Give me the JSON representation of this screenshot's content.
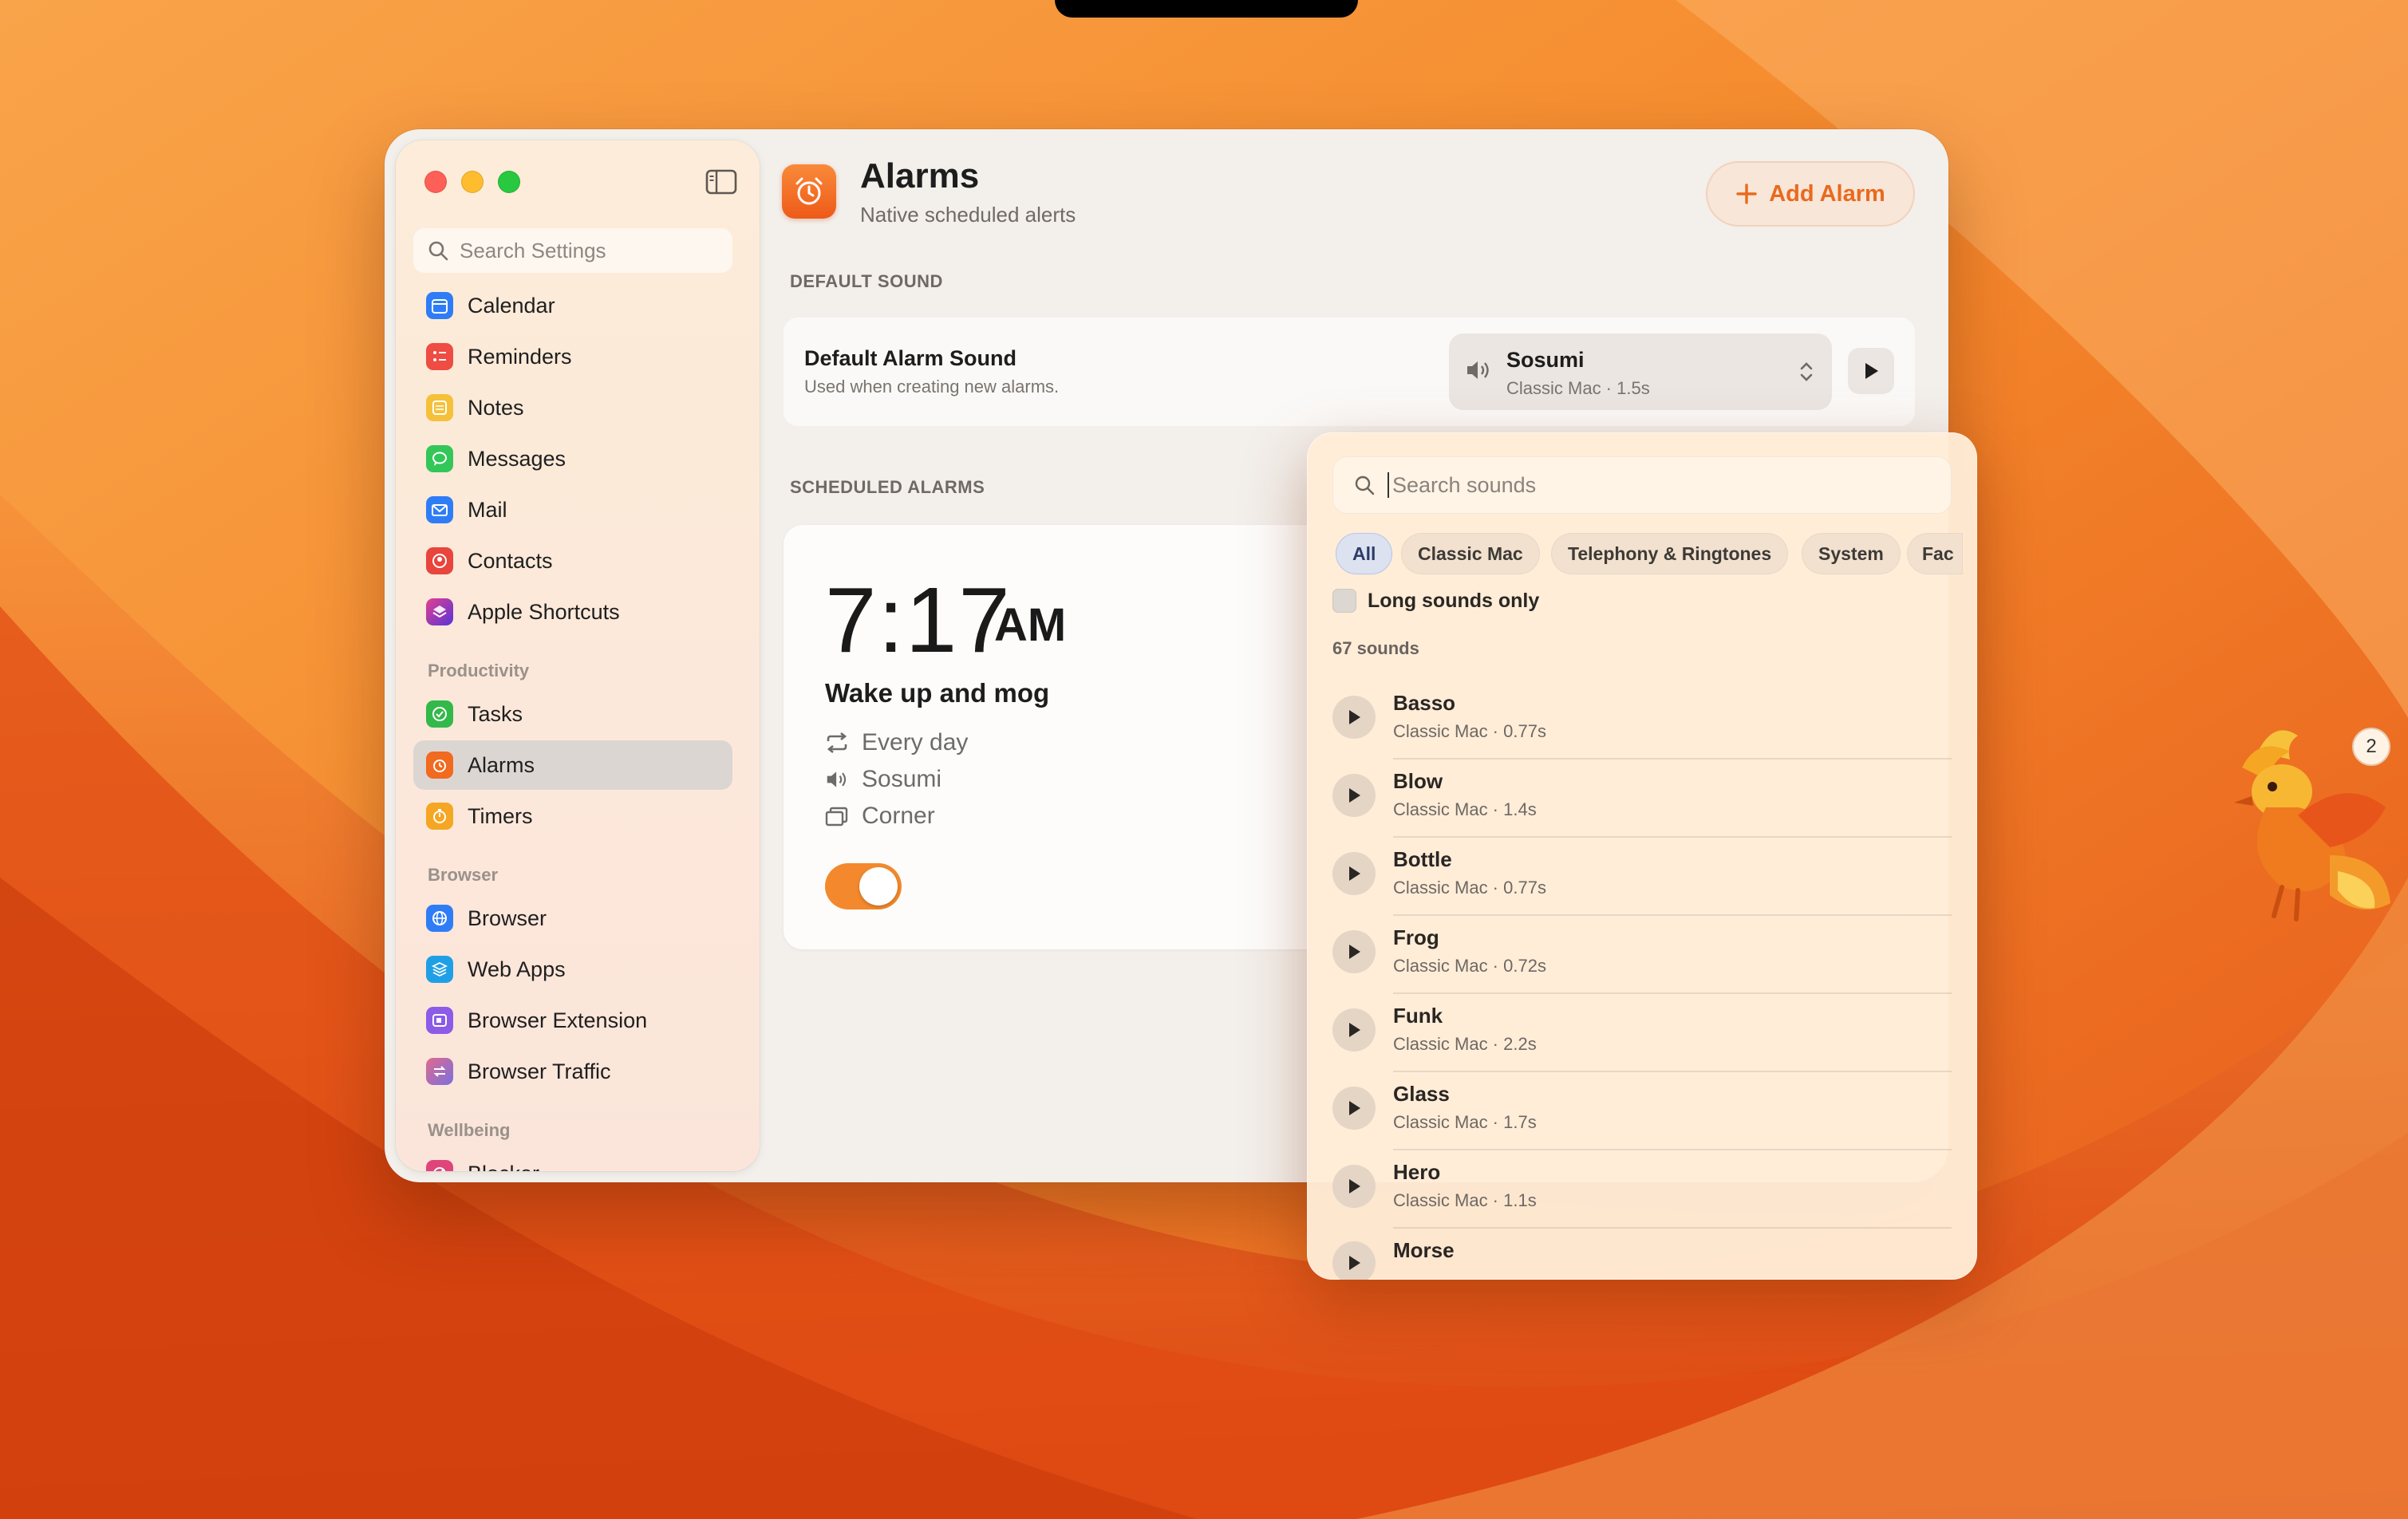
{
  "sidebar": {
    "search_placeholder": "Search Settings",
    "items": [
      {
        "label": "Calendar",
        "icon": "calendar-icon",
        "color": "#2f7df6"
      },
      {
        "label": "Reminders",
        "icon": "reminders-icon",
        "color": "#ef4c43"
      },
      {
        "label": "Notes",
        "icon": "notes-icon",
        "color": "#f5c13a"
      },
      {
        "label": "Messages",
        "icon": "messages-icon",
        "color": "#33c759"
      },
      {
        "label": "Mail",
        "icon": "mail-icon",
        "color": "#2f7df6"
      },
      {
        "label": "Contacts",
        "icon": "contacts-icon",
        "color": "#e8453c"
      },
      {
        "label": "Apple Shortcuts",
        "icon": "shortcuts-icon",
        "color": "#7c3cd9"
      }
    ],
    "section_productivity": "Productivity",
    "productivity_items": [
      {
        "label": "Tasks",
        "icon": "tasks-icon",
        "color": "#33b84a"
      },
      {
        "label": "Alarms",
        "icon": "alarm-icon",
        "color": "#f06a1f"
      },
      {
        "label": "Timers",
        "icon": "timer-icon",
        "color": "#f5a623"
      }
    ],
    "section_browser": "Browser",
    "browser_items": [
      {
        "label": "Browser",
        "icon": "globe-icon",
        "color": "#2f7df6"
      },
      {
        "label": "Web Apps",
        "icon": "web-apps-icon",
        "color": "#1fa0e6"
      },
      {
        "label": "Browser Extension",
        "icon": "extension-icon",
        "color": "#8c5be8"
      },
      {
        "label": "Browser Traffic",
        "icon": "traffic-icon",
        "color": "#8a6fd6"
      }
    ],
    "section_wellbeing": "Wellbeing",
    "wellbeing_items": [
      {
        "label": "Blocker",
        "icon": "blocker-icon",
        "color": "#e0457a"
      }
    ]
  },
  "header": {
    "title": "Alarms",
    "subtitle": "Native scheduled alerts",
    "add_label": "Add Alarm"
  },
  "default_sound": {
    "section": "DEFAULT SOUND",
    "title": "Default Alarm Sound",
    "subtitle": "Used when creating new alarms.",
    "selected_name": "Sosumi",
    "selected_meta": "Classic Mac · 1.5s"
  },
  "scheduled": {
    "section": "SCHEDULED ALARMS",
    "alarm": {
      "time": "7:17",
      "ampm": "AM",
      "label": "Wake up and mog",
      "repeat": "Every day",
      "sound": "Sosumi",
      "position": "Corner",
      "enabled": true
    }
  },
  "popover": {
    "search_placeholder": "Search sounds",
    "chips": [
      "All",
      "Classic Mac",
      "Telephony & Ringtones",
      "System",
      "Fac"
    ],
    "selected_chip": "All",
    "long_only_label": "Long sounds only",
    "count_label": "67 sounds",
    "sounds": [
      {
        "name": "Basso",
        "meta": "Classic Mac · 0.77s"
      },
      {
        "name": "Blow",
        "meta": "Classic Mac · 1.4s"
      },
      {
        "name": "Bottle",
        "meta": "Classic Mac · 0.77s"
      },
      {
        "name": "Frog",
        "meta": "Classic Mac · 0.72s"
      },
      {
        "name": "Funk",
        "meta": "Classic Mac · 2.2s"
      },
      {
        "name": "Glass",
        "meta": "Classic Mac · 1.7s"
      },
      {
        "name": "Hero",
        "meta": "Classic Mac · 1.1s"
      },
      {
        "name": "Morse",
        "meta": ""
      }
    ]
  },
  "desktop": {
    "badge_count": "2"
  },
  "colors": {
    "accent": "#f06a1f",
    "window_bg": "#f3efeb",
    "wallpaper": "#f07a1e"
  }
}
